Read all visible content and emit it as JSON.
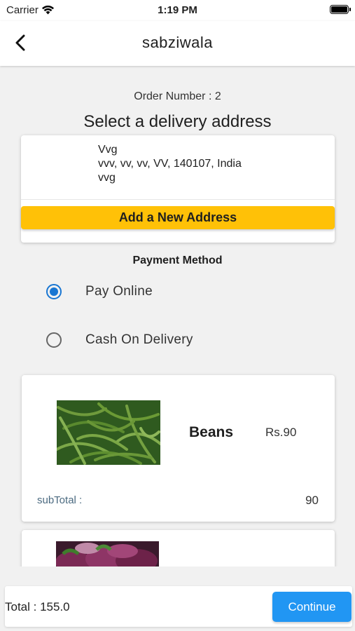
{
  "status_bar": {
    "carrier": "Carrier",
    "time": "1:19 PM"
  },
  "app_bar": {
    "title": "sabziwala",
    "back_icon": "chevron-left-icon"
  },
  "order": {
    "number_text": "Order Number : 2"
  },
  "address_section": {
    "heading": "Select a delivery address",
    "address": {
      "name": "Vvg",
      "line": "vvv, vv, vv, VV, 140107, India",
      "note": "vvg"
    },
    "add_button_label": "Add a New Address"
  },
  "payment": {
    "heading": "Payment Method",
    "options": [
      {
        "label": "Pay Online",
        "selected": true
      },
      {
        "label": "Cash On Delivery",
        "selected": false
      }
    ],
    "accent_color": "#1976d2"
  },
  "cart": {
    "items": [
      {
        "name": "Beans",
        "price": "Rs.90",
        "subtotal_label": "subTotal :",
        "subtotal_value": "90",
        "image": "green-beans-photo"
      },
      {
        "image": "eggplant-photo"
      }
    ]
  },
  "footer": {
    "total_text": "Total : 155.0",
    "continue_label": "Continue",
    "continue_color": "#2196f3"
  },
  "colors": {
    "add_address_button": "#ffc107"
  }
}
